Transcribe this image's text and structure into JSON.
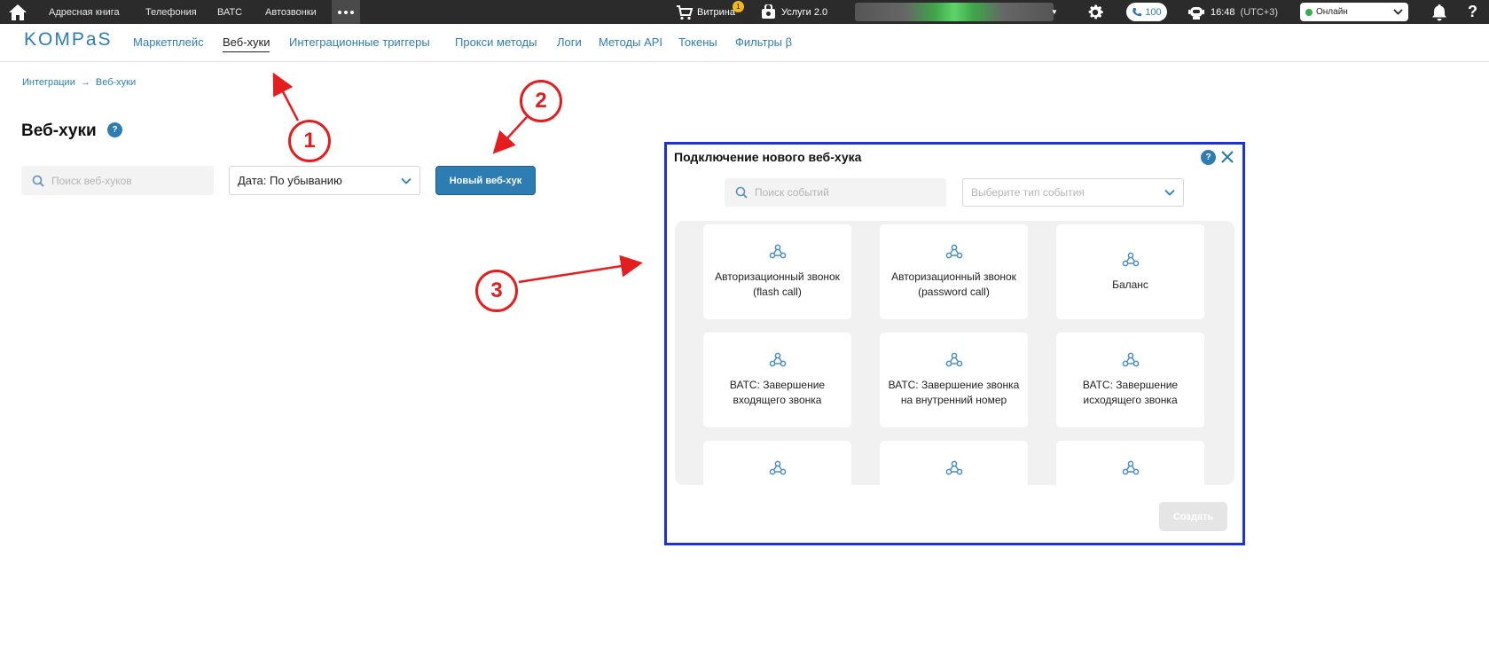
{
  "topbar": {
    "nav": [
      "Адресная книга",
      "Телефония",
      "ВАТС",
      "Автозвонки"
    ],
    "vitrina_label": "Витрина",
    "vitrina_badge": "1",
    "services_label": "Услуги 2.0",
    "calls_count": "100",
    "time": "16:48",
    "timezone": "(UTC+3)",
    "status": "Онлайн"
  },
  "subnav": {
    "logo": "KOMPaS",
    "items": [
      "Маркетплейс",
      "Веб-хуки",
      "Интеграционные триггеры",
      "Прокси методы",
      "Логи",
      "Методы API",
      "Токены",
      "Фильтры β"
    ],
    "active_index": 1
  },
  "breadcrumb": [
    "Интеграции",
    "Веб-хуки"
  ],
  "page": {
    "title": "Веб-хуки",
    "search_placeholder": "Поиск веб-хуков",
    "sort_value": "Дата: По убыванию",
    "new_button": "Новый веб-хук"
  },
  "modal": {
    "title": "Подключение нового веб-хука",
    "search_placeholder": "Поиск событий",
    "type_placeholder": "Выберите тип события",
    "cards": [
      "Авторизационный звонок (flash call)",
      "Авторизационный звонок (password call)",
      "Баланс",
      "ВАТС: Завершение входящего звонка",
      "ВАТС: Завершение звонка на внутренний номер",
      "ВАТС: Завершение исходящего звонка",
      "",
      "",
      ""
    ],
    "create_button": "Создать"
  },
  "annotations": [
    "1",
    "2",
    "3"
  ],
  "colors": {
    "accent": "#2e7db2",
    "topbar": "#2b2b2b",
    "annotation": "#e41e1e",
    "modal_border": "#1c31e0"
  }
}
